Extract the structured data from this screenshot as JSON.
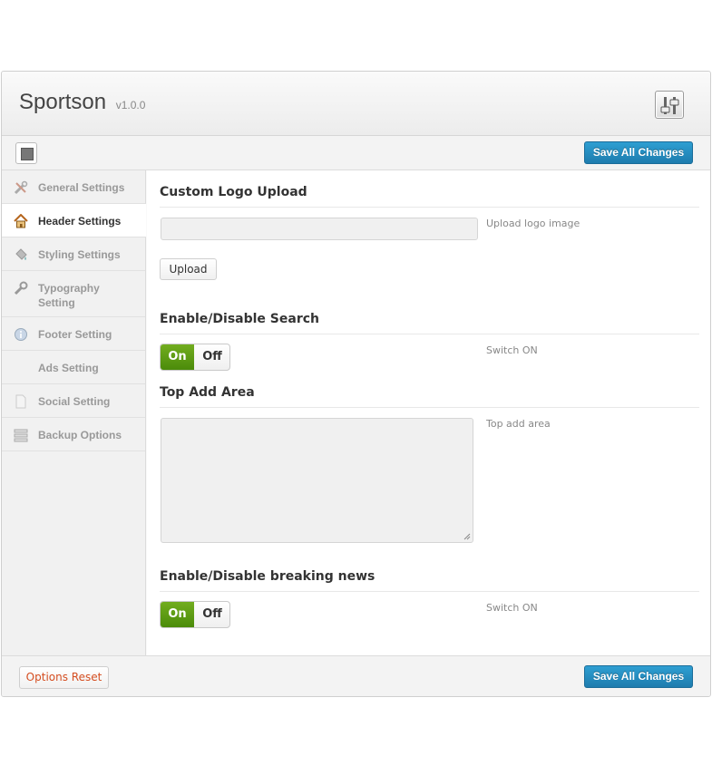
{
  "app": {
    "title": "Sportson",
    "version": "v1.0.0"
  },
  "toolbar": {
    "save_label": "Save All Changes"
  },
  "sidebar": {
    "items": [
      {
        "label": "General Settings",
        "icon": "tools-icon",
        "active": false
      },
      {
        "label": "Header Settings",
        "icon": "home-icon",
        "active": true
      },
      {
        "label": "Styling Settings",
        "icon": "paint-bucket-icon",
        "active": false
      },
      {
        "label": "Typography Setting",
        "icon": "wrench-icon",
        "active": false
      },
      {
        "label": "Footer Setting",
        "icon": "info-icon",
        "active": false
      },
      {
        "label": "Ads Setting",
        "icon": "",
        "active": false
      },
      {
        "label": "Social Setting",
        "icon": "document-icon",
        "active": false
      },
      {
        "label": "Backup Options",
        "icon": "stack-icon",
        "active": false
      }
    ]
  },
  "content": {
    "logo": {
      "title": "Custom Logo Upload",
      "value": "",
      "help": "Upload logo image",
      "button": "Upload"
    },
    "search": {
      "title": "Enable/Disable Search",
      "on": "On",
      "off": "Off",
      "help": "Switch ON"
    },
    "top_add": {
      "title": "Top Add Area",
      "value": "",
      "help": "Top add area"
    },
    "breaking": {
      "title": "Enable/Disable breaking news",
      "on": "On",
      "off": "Off",
      "help": "Switch ON"
    }
  },
  "footer": {
    "reset_label": "Options Reset",
    "save_label": "Save All Changes"
  },
  "colors": {
    "accent": "#2188c0",
    "switch_on": "#5e9c14",
    "reset_text": "#d54e21"
  }
}
